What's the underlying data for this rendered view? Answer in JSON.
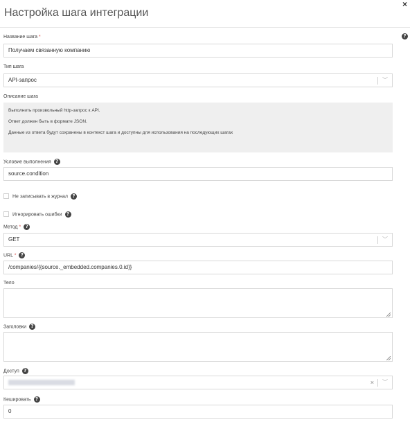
{
  "dialog": {
    "title": "Настройка шага интеграции",
    "close_symbol": "×"
  },
  "fields": {
    "name": {
      "label": "Название шага",
      "required_mark": "*",
      "value": "Получаем связанную компанию"
    },
    "type": {
      "label": "Тип шага",
      "value": "API-запрос"
    },
    "description": {
      "label": "Описание шага",
      "lines": [
        "Выполнить произвольный http-запрос к API.",
        "Ответ должен быть в формате JSON.",
        "Данные из ответа будут сохранены в контекст шага и доступны для использования на последующих шагах"
      ]
    },
    "condition": {
      "label": "Условие выполнения",
      "value": "source.condition"
    },
    "no_log": {
      "label": "Не записывать в журнал",
      "checked": false
    },
    "ignore_errors": {
      "label": "Игнорировать ошибки",
      "checked": false
    },
    "method": {
      "label": "Метод",
      "required_mark": "*",
      "value": "GET"
    },
    "url": {
      "label": "URL",
      "required_mark": "*",
      "value": "/companies/{{source._embedded.companies.0.id}}"
    },
    "body": {
      "label": "Тело",
      "value": ""
    },
    "headers": {
      "label": "Заголовки",
      "value": ""
    },
    "access": {
      "label": "Доступ",
      "clear_symbol": "×"
    },
    "cache": {
      "label": "Кешировать",
      "value": "0"
    }
  },
  "icons": {
    "help": "question-circle-icon",
    "chevron": "chevron-down-icon",
    "close": "close-icon"
  }
}
